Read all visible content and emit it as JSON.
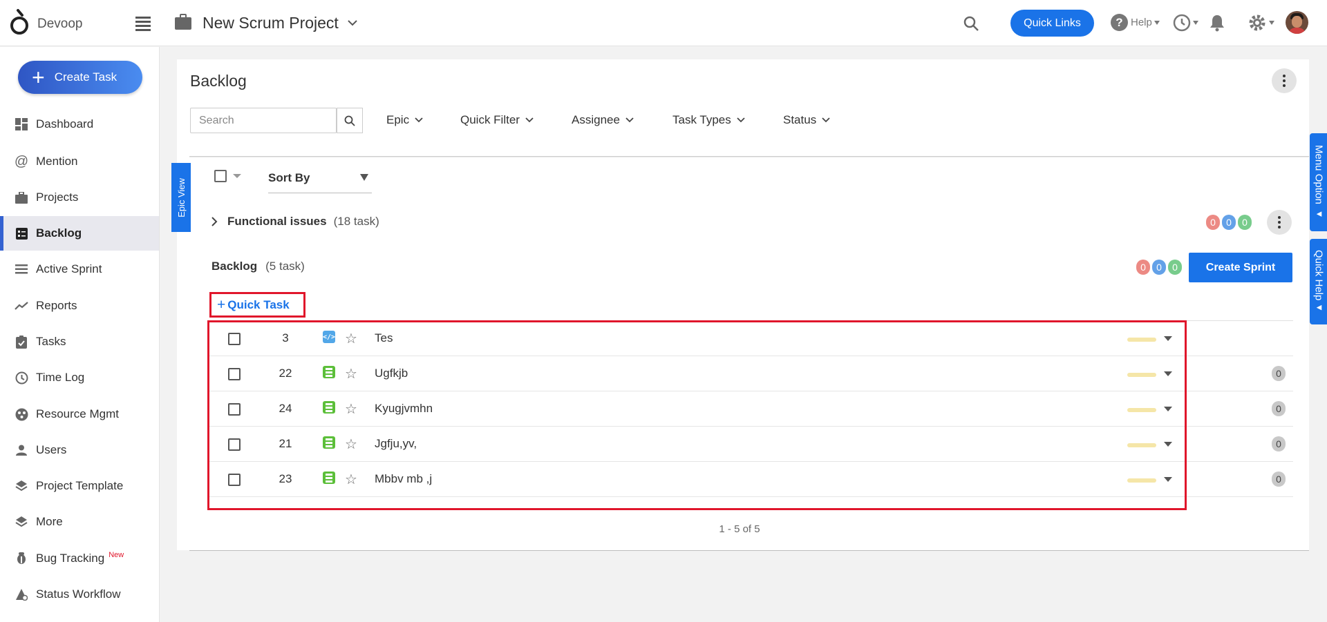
{
  "app": {
    "logo_text": "Devoop"
  },
  "header": {
    "project_title": "New Scrum Project",
    "quick_links_label": "Quick Links",
    "help_label": "Help"
  },
  "sidebar": {
    "create_task_label": "Create Task",
    "items": [
      {
        "label": "Dashboard",
        "icon": "dashboard-icon"
      },
      {
        "label": "Mention",
        "icon": "at-icon"
      },
      {
        "label": "Projects",
        "icon": "briefcase-icon"
      },
      {
        "label": "Backlog",
        "icon": "backlog-icon",
        "active": true
      },
      {
        "label": "Active Sprint",
        "icon": "sprint-icon"
      },
      {
        "label": "Reports",
        "icon": "chart-line-icon"
      },
      {
        "label": "Tasks",
        "icon": "clipboard-check-icon"
      },
      {
        "label": "Time Log",
        "icon": "clock-icon"
      },
      {
        "label": "Resource Mgmt",
        "icon": "resource-icon"
      },
      {
        "label": "Users",
        "icon": "user-icon"
      },
      {
        "label": "Project Template",
        "icon": "layers-icon"
      },
      {
        "label": "More",
        "icon": "layers-icon"
      },
      {
        "label": "Bug Tracking",
        "icon": "bug-icon",
        "badge": "New"
      },
      {
        "label": "Status Workflow",
        "icon": "workflow-icon"
      }
    ]
  },
  "main": {
    "title": "Backlog",
    "search_placeholder": "Search",
    "filters": [
      "Epic",
      "Quick Filter",
      "Assignee",
      "Task Types",
      "Status"
    ],
    "epic_view_label": "Epic View",
    "sort_by_label": "Sort By",
    "epic_group": {
      "name": "Functional issues",
      "count": "(18 task)",
      "dots": [
        "0",
        "0",
        "0"
      ]
    },
    "backlog": {
      "name": "Backlog",
      "count": "(5 task)",
      "dots": [
        "0",
        "0",
        "0"
      ],
      "create_sprint_label": "Create Sprint",
      "quick_task_label": "Quick Task"
    },
    "tasks": [
      {
        "id": "3",
        "type": "code",
        "title": "Tes",
        "badge": ""
      },
      {
        "id": "22",
        "type": "story",
        "title": "Ugfkjb",
        "badge": "0"
      },
      {
        "id": "24",
        "type": "story",
        "title": "Kyugjvmhn",
        "badge": "0"
      },
      {
        "id": "21",
        "type": "story",
        "title": "Jgfju,yv,",
        "badge": "0"
      },
      {
        "id": "23",
        "type": "story",
        "title": "Mbbv mb ,j",
        "badge": "0"
      }
    ],
    "pager_text": "1 - 5 of 5"
  },
  "side_tabs": {
    "menu_option": "Menu Option ◂",
    "quick_help": "Quick Help◂"
  },
  "colors": {
    "accent": "#1a73e8",
    "highlight_box": "#e0162b",
    "dot_red": "#ec8a84",
    "dot_blue": "#63a1e8",
    "dot_green": "#78cc8c"
  }
}
